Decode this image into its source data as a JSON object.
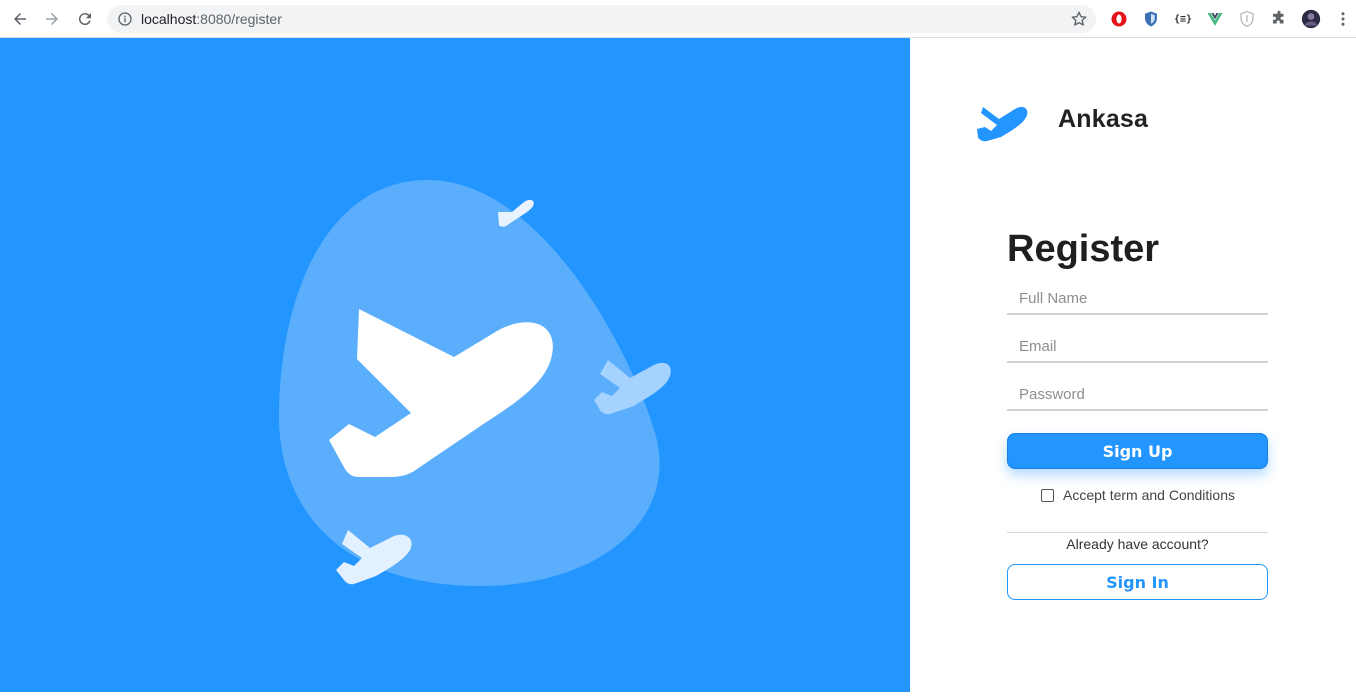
{
  "browser": {
    "url_host": "localhost",
    "url_rest": ":8080/register"
  },
  "brand": {
    "name": "Ankasa",
    "accent": "#2395ff"
  },
  "form": {
    "title": "Register",
    "full_name_placeholder": "Full Name",
    "email_placeholder": "Email",
    "password_placeholder": "Password",
    "full_name_value": "",
    "email_value": "",
    "password_value": "",
    "signup_label": "Sign Up",
    "terms_label": "Accept term and Conditions",
    "terms_checked": false,
    "already_text": "Already have account?",
    "signin_label": "Sign In"
  },
  "icons": {
    "back": "arrow-left-icon",
    "forward": "arrow-right-icon",
    "reload": "reload-icon",
    "info": "info-icon",
    "star": "star-icon",
    "extensions": [
      "opera-icon",
      "shield-icon",
      "json-viewer-icon",
      "vue-devtools-icon",
      "privacy-shield-icon",
      "puzzle-icon",
      "profile-avatar"
    ],
    "menu": "kebab-menu-icon"
  }
}
